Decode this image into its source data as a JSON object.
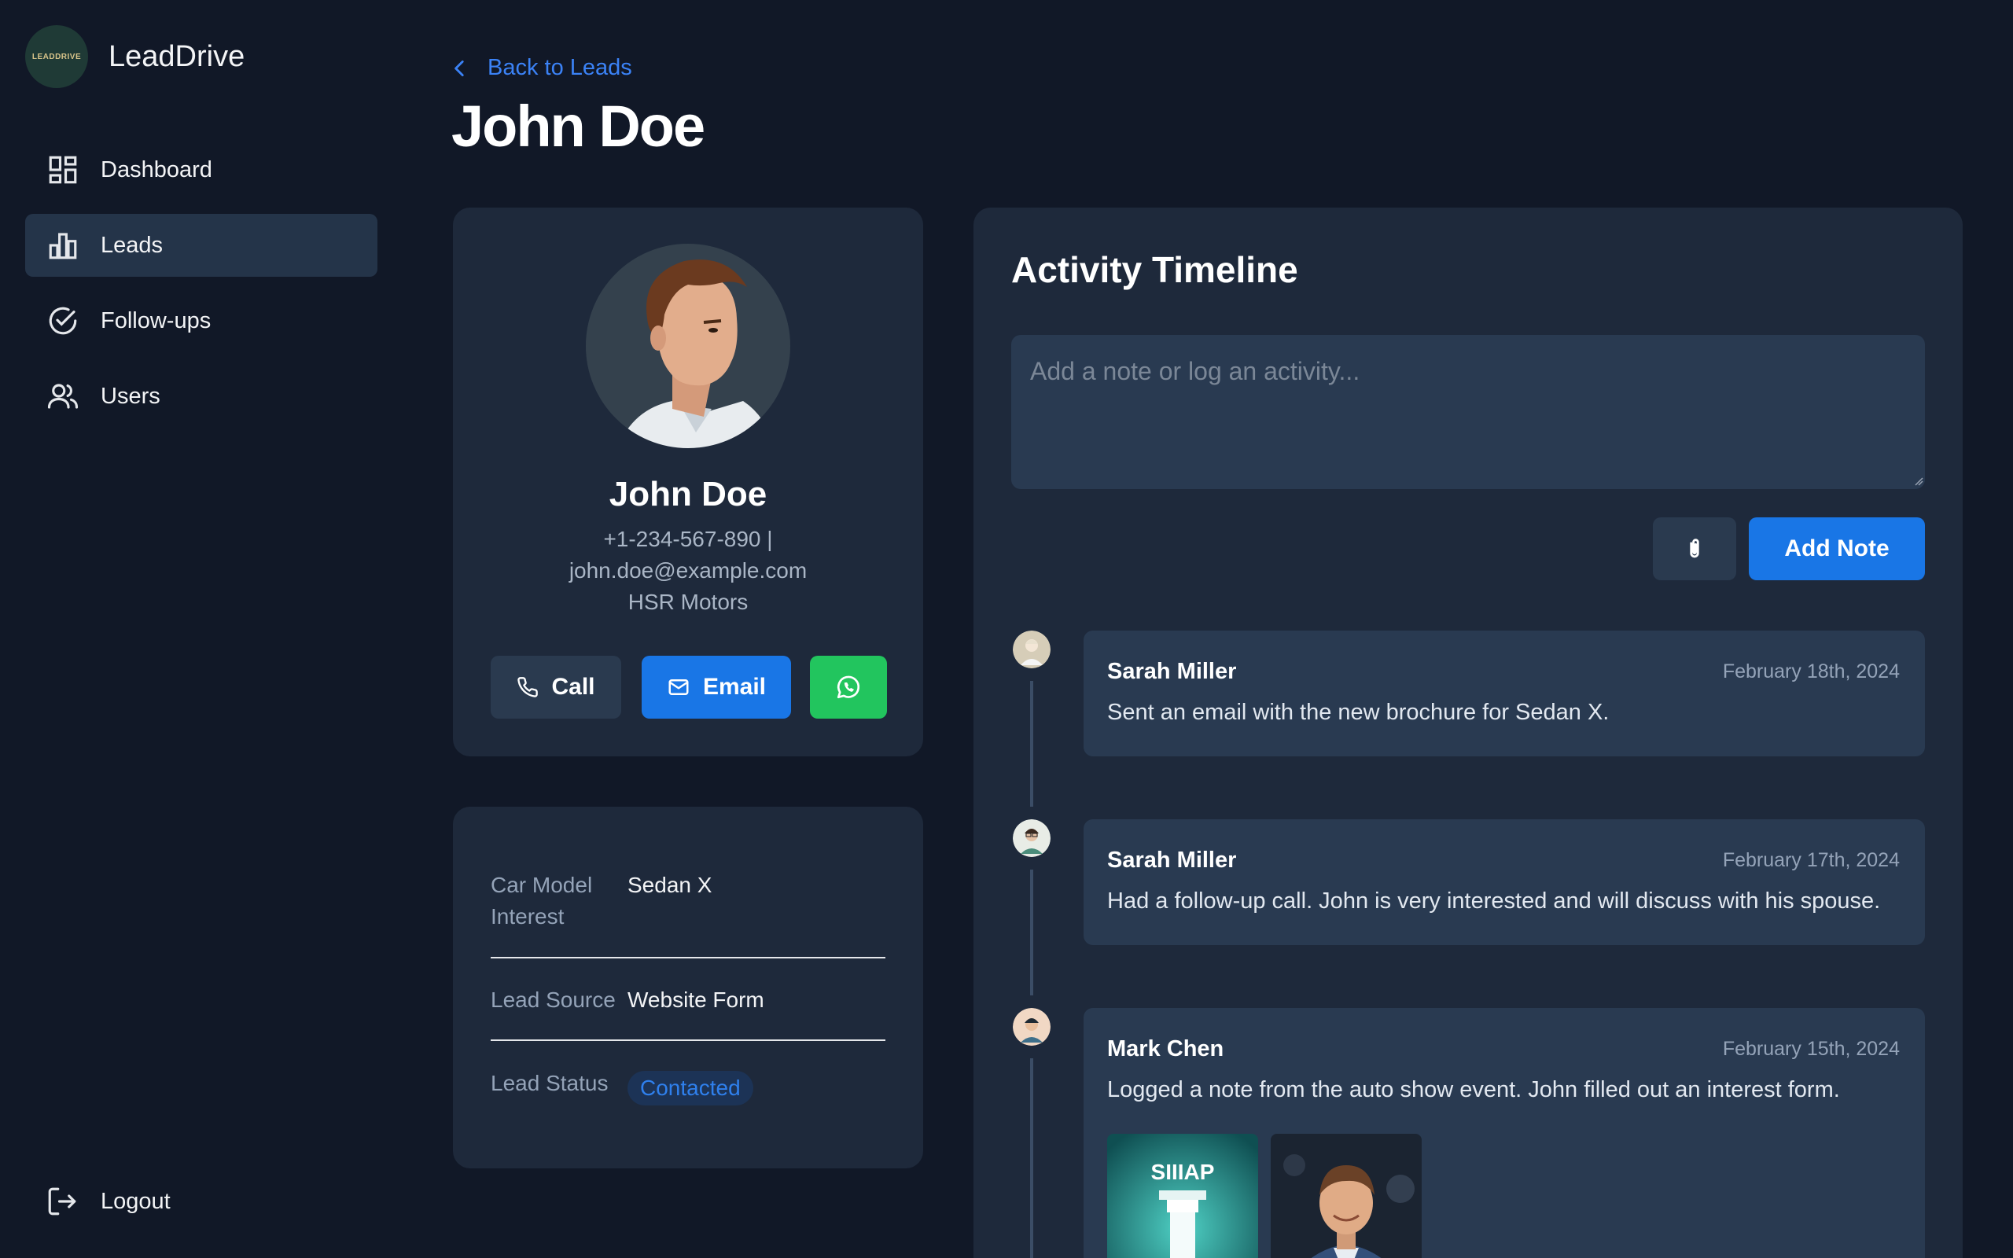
{
  "app": {
    "name": "LeadDrive",
    "logo_text": "LEADDRIVE"
  },
  "sidebar": {
    "items": [
      {
        "label": "Dashboard",
        "icon": "dashboard-icon"
      },
      {
        "label": "Leads",
        "icon": "bar-chart-icon",
        "active": true
      },
      {
        "label": "Follow-ups",
        "icon": "check-circle-icon"
      },
      {
        "label": "Users",
        "icon": "users-icon"
      }
    ],
    "logout_label": "Logout"
  },
  "header": {
    "back_label": "Back to Leads",
    "title": "John Doe"
  },
  "profile": {
    "name": "John Doe",
    "phone_line": "+1-234-567-890 |",
    "email": "john.doe@example.com",
    "company": "HSR Motors",
    "actions": {
      "call_label": "Call",
      "email_label": "Email",
      "whatsapp_icon": "whatsapp-icon"
    }
  },
  "details": {
    "car_model_label": "Car Model Interest",
    "car_model_value": "Sedan X",
    "lead_source_label": "Lead Source",
    "lead_source_value": "Website Form",
    "lead_status_label": "Lead Status",
    "lead_status_value": "Contacted"
  },
  "activity": {
    "title": "Activity Timeline",
    "input_placeholder": "Add a note or log an activity...",
    "add_note_label": "Add Note",
    "entries": [
      {
        "author": "Sarah Miller",
        "date": "February 18th, 2024",
        "text": "Sent an email with the new brochure for Sedan X."
      },
      {
        "author": "Sarah Miller",
        "date": "February 17th, 2024",
        "text": "Had a follow-up call. John is very interested and will discuss with his spouse."
      },
      {
        "author": "Mark Chen",
        "date": "February 15th, 2024",
        "text": "Logged a note from the auto show event. John filled out an interest form.",
        "attachment_text": "SIIIAP"
      }
    ]
  },
  "colors": {
    "background": "#111827",
    "card": "#1e293b",
    "accent": "#1976e6",
    "whatsapp": "#22c55e",
    "link": "#3b82f6"
  }
}
